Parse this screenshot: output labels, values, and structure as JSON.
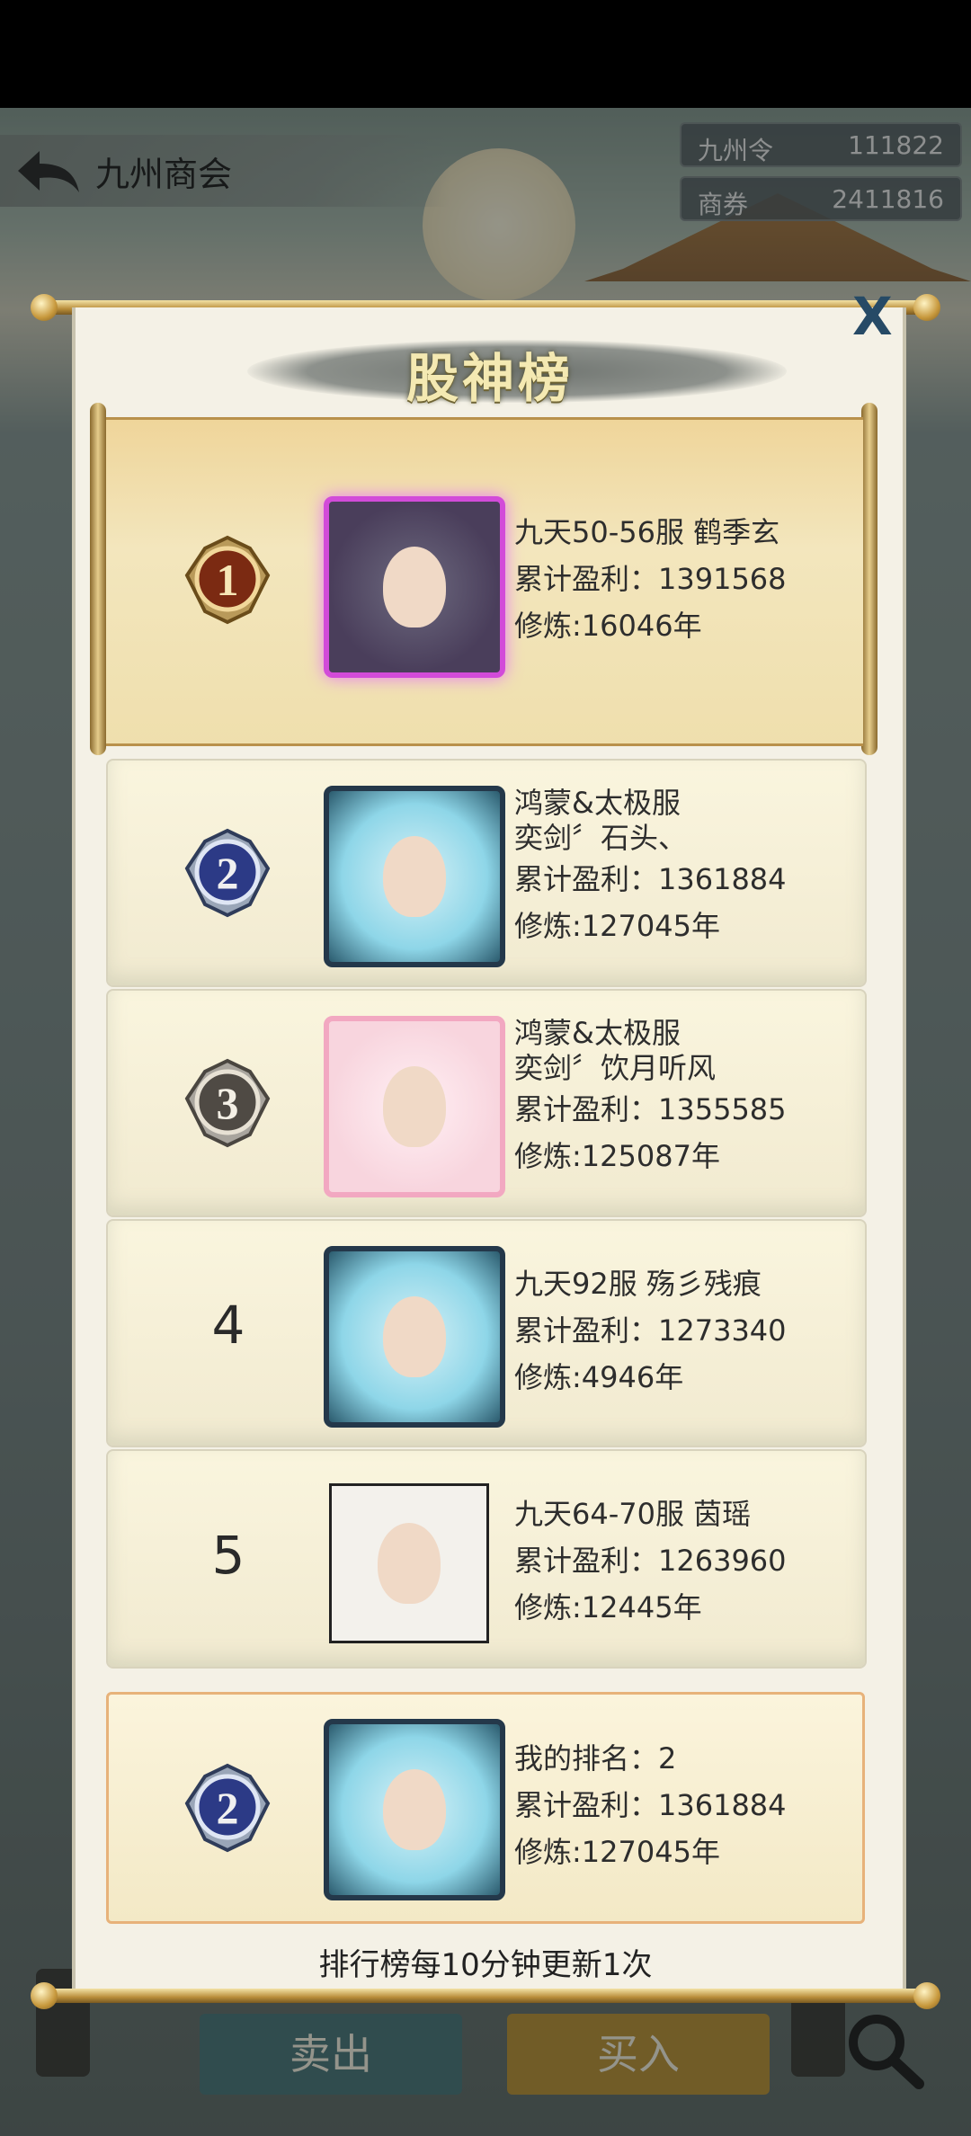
{
  "header": {
    "title": "九州商会",
    "currencies": [
      {
        "label": "九州令",
        "value": "111822"
      },
      {
        "label": "商券",
        "value": "2411816"
      }
    ]
  },
  "dialog": {
    "title": "股神榜",
    "close_label": "X",
    "footer_note": "排行榜每10分钟更新1次"
  },
  "ranking": [
    {
      "rank": "1",
      "server": "九天50-56服 鹤季玄",
      "name": "",
      "profit": "累计盈利：1391568",
      "cultivation": "修炼:16046年"
    },
    {
      "rank": "2",
      "server": "鸿蒙&太极服",
      "name": "奕剑〞石头、",
      "profit": "累计盈利：1361884",
      "cultivation": "修炼:127045年"
    },
    {
      "rank": "3",
      "server": "鸿蒙&太极服",
      "name": "奕剑〞饮月听风",
      "profit": "累计盈利：1355585",
      "cultivation": "修炼:125087年"
    },
    {
      "rank": "4",
      "server": "九天92服 殇彡残痕",
      "name": "",
      "profit": "累计盈利：1273340",
      "cultivation": "修炼:4946年"
    },
    {
      "rank": "5",
      "server": "九天64-70服 茵瑶",
      "name": "",
      "profit": "累计盈利：1263960",
      "cultivation": "修炼:12445年"
    }
  ],
  "my_rank": {
    "rank": "2",
    "label": "我的排名：2",
    "profit": "累计盈利：1361884",
    "cultivation": "修炼:127045年"
  },
  "bottom": {
    "sell_label": "卖出",
    "buy_label": "买入"
  }
}
